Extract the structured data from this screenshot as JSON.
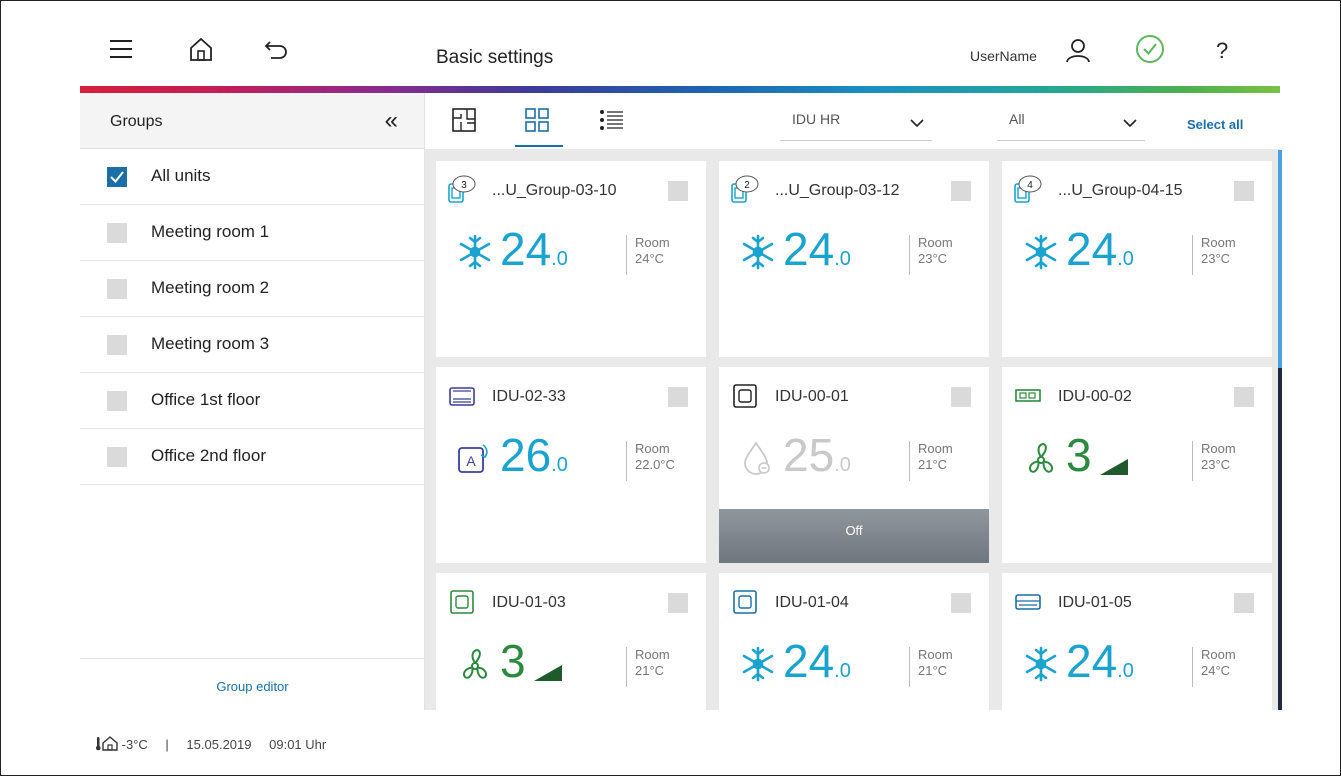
{
  "header": {
    "title": "Basic settings",
    "username": "UserName",
    "icons": [
      "menu-icon",
      "home-icon",
      "back-icon",
      "user-icon",
      "check-circle-icon",
      "help-icon"
    ],
    "accent": "#1a6fa8",
    "ok_color": "#5cb85c"
  },
  "sidebar": {
    "title": "Groups",
    "collapse_glyph": "«",
    "items": [
      {
        "label": "All units",
        "checked": true
      },
      {
        "label": "Meeting room 1",
        "checked": false
      },
      {
        "label": "Meeting room 2",
        "checked": false
      },
      {
        "label": "Meeting room 3",
        "checked": false
      },
      {
        "label": "Office 1st floor",
        "checked": false
      },
      {
        "label": "Office 2nd floor",
        "checked": false
      }
    ],
    "footer_link": "Group editor"
  },
  "toolbar": {
    "views": [
      "floorplan-view-icon",
      "grid-view-icon",
      "list-view-icon"
    ],
    "active_view": "grid-view-icon",
    "unit_type": "IDU HR",
    "filter": "All",
    "select_all": "Select all"
  },
  "cards": [
    {
      "name": "...U_Group-03-10",
      "badge": "3",
      "mode": "cool",
      "temp_int": "24",
      "temp_dec": ".0",
      "room_label": "Room",
      "room_temp": "24°C"
    },
    {
      "name": "...U_Group-03-12",
      "badge": "2",
      "mode": "cool",
      "temp_int": "24",
      "temp_dec": ".0",
      "room_label": "Room",
      "room_temp": "23°C"
    },
    {
      "name": "...U_Group-04-15",
      "badge": "4",
      "mode": "cool",
      "temp_int": "24",
      "temp_dec": ".0",
      "room_label": "Room",
      "room_temp": "23°C"
    },
    {
      "name": "IDU-02-33",
      "mode": "auto",
      "temp_int": "26",
      "temp_dec": ".0",
      "room_label": "Room",
      "room_temp": "22.0°C"
    },
    {
      "name": "IDU-00-01",
      "mode": "dry",
      "temp_int": "25",
      "temp_dec": ".0",
      "room_label": "Room",
      "room_temp": "21°C",
      "status": "Off"
    },
    {
      "name": "IDU-00-02",
      "mode": "fan",
      "temp_int": "3",
      "temp_dec": "",
      "room_label": "Room",
      "room_temp": "23°C"
    },
    {
      "name": "IDU-01-03",
      "mode": "fan",
      "temp_int": "3",
      "temp_dec": "",
      "room_label": "Room",
      "room_temp": "21°C"
    },
    {
      "name": "IDU-01-04",
      "mode": "cool",
      "temp_int": "24",
      "temp_dec": ".0",
      "room_label": "Room",
      "room_temp": "21°C"
    },
    {
      "name": "IDU-01-05",
      "mode": "cool",
      "temp_int": "24",
      "temp_dec": ".0",
      "room_label": "Room",
      "room_temp": "24°C"
    }
  ],
  "status": {
    "outside_temp": "-3°C",
    "separator": "|",
    "date": "15.05.2019",
    "time": "09:01 Uhr"
  }
}
